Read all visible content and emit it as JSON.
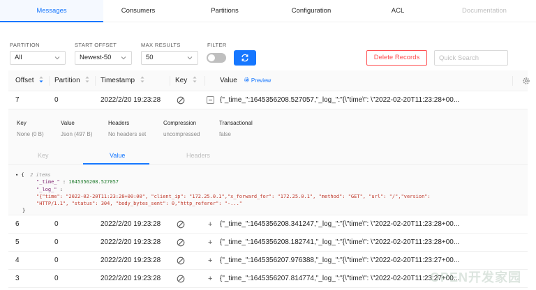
{
  "tabs": [
    "Messages",
    "Consumers",
    "Partitions",
    "Configuration",
    "ACL",
    "Documentation"
  ],
  "filters": {
    "partition_label": "PARTITION",
    "partition_value": "All",
    "start_offset_label": "START OFFSET",
    "start_offset_value": "Newest-50",
    "max_results_label": "MAX RESULTS",
    "max_results_value": "50",
    "filter_label": "FILTER",
    "delete_label": "Delete Records",
    "search_placeholder": "Quick Search"
  },
  "columns": {
    "offset": "Offset",
    "partition": "Partition",
    "timestamp": "Timestamp",
    "key": "Key",
    "value": "Value",
    "preview": "Preview"
  },
  "expanded_row": {
    "offset": "7",
    "partition": "0",
    "timestamp": "2022/2/20 19:23:28",
    "value": "{\"_time_\":1645356208.527057,\"_log_\":\"{\\\"time\\\": \\\"2022-02-20T11:23:28+00...",
    "meta": {
      "key_h": "Key",
      "key_v": "None (0 B)",
      "value_h": "Value",
      "value_v": "Json (497 B)",
      "headers_h": "Headers",
      "headers_v": "No headers set",
      "compression_h": "Compression",
      "compression_v": "uncompressed",
      "transactional_h": "Transactional",
      "transactional_v": "false"
    },
    "subtabs": [
      "Key",
      "Value",
      "Headers"
    ],
    "json": {
      "open": "{",
      "items": "2 items",
      "k1": "\"_time_\"",
      "v1": "1645356208.527057",
      "k2": "\"_log_\"",
      "v2_line1": "\"{\"time\": \"2022-02-20T11:23:28+00:00\", \"client_ip\": \"172.25.0.1\",\"x_forward_for\": \"172.25.0.1\", \"method\": \"GET\", \"url\": \"/\",\"version\":",
      "v2_line2": "\"HTTP/1.1\", \"status\": 304, \"body_bytes_sent\": 0,\"http_referer\": \"-...\"",
      "close": "}"
    }
  },
  "rows": [
    {
      "offset": "6",
      "partition": "0",
      "timestamp": "2022/2/20 19:23:28",
      "value": "{\"_time_\":1645356208.341247,\"_log_\":\"{\\\"time\\\": \\\"2022-02-20T11:23:28+00..."
    },
    {
      "offset": "5",
      "partition": "0",
      "timestamp": "2022/2/20 19:23:28",
      "value": "{\"_time_\":1645356208.182741,\"_log_\":\"{\\\"time\\\": \\\"2022-02-20T11:23:28+00..."
    },
    {
      "offset": "4",
      "partition": "0",
      "timestamp": "2022/2/20 19:23:28",
      "value": "{\"_time_\":1645356207.976388,\"_log_\":\"{\\\"time\\\": \\\"2022-02-20T11:23:27+00..."
    },
    {
      "offset": "3",
      "partition": "0",
      "timestamp": "2022/2/20 19:23:28",
      "value": "{\"_time_\":1645356207.814774,\"_log_\":\"{\\\"time\\\": \\\"2022-02-20T11:23:27+00..."
    }
  ],
  "watermark": "OPEN开发家园",
  "colors": {
    "accent": "#1677ff",
    "danger": "#ff4d4f"
  }
}
